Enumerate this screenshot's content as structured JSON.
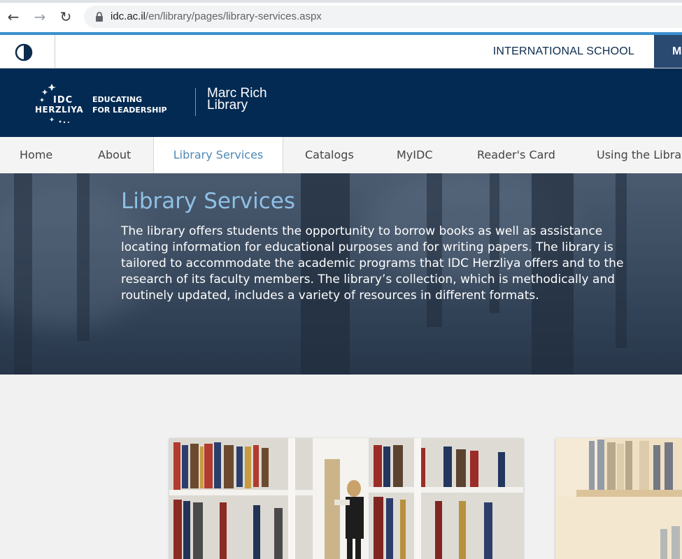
{
  "browser": {
    "url_host": "idc.ac.il",
    "url_path": "/en/library/pages/library-services.aspx"
  },
  "utility_bar": {
    "international_label": "INTERNATIONAL SCHOOL",
    "cut_tab_label": "M"
  },
  "header": {
    "logo_idc": "IDC",
    "logo_herzliya": "HERZLIYA",
    "logo_tagline_1": "EDUCATING",
    "logo_tagline_2": "FOR LEADERSHIP",
    "library_name_1": "Marc Rich",
    "library_name_2": "Library"
  },
  "nav": {
    "items": [
      {
        "label": "Home"
      },
      {
        "label": "About"
      },
      {
        "label": "Library Services"
      },
      {
        "label": "Catalogs"
      },
      {
        "label": "MyIDC"
      },
      {
        "label": "Reader's Card"
      },
      {
        "label": "Using the Librar"
      }
    ],
    "active_index": 2
  },
  "hero": {
    "title": "Library Services",
    "description": "The library offers students the opportunity to borrow books as well as assistance locating information for educational purposes and for writing papers. The library is tailored to accommodate the academic programs that IDC Herzliya offers and to the research of its faculty members. The library’s collection, which is methodically and routinely updated, includes a variety of resources in different formats."
  },
  "colors": {
    "header_bg": "#032a52",
    "accent_blue": "#3b8fd0",
    "active_nav_text": "#4d88b5",
    "hero_title": "#8fc0e6"
  }
}
